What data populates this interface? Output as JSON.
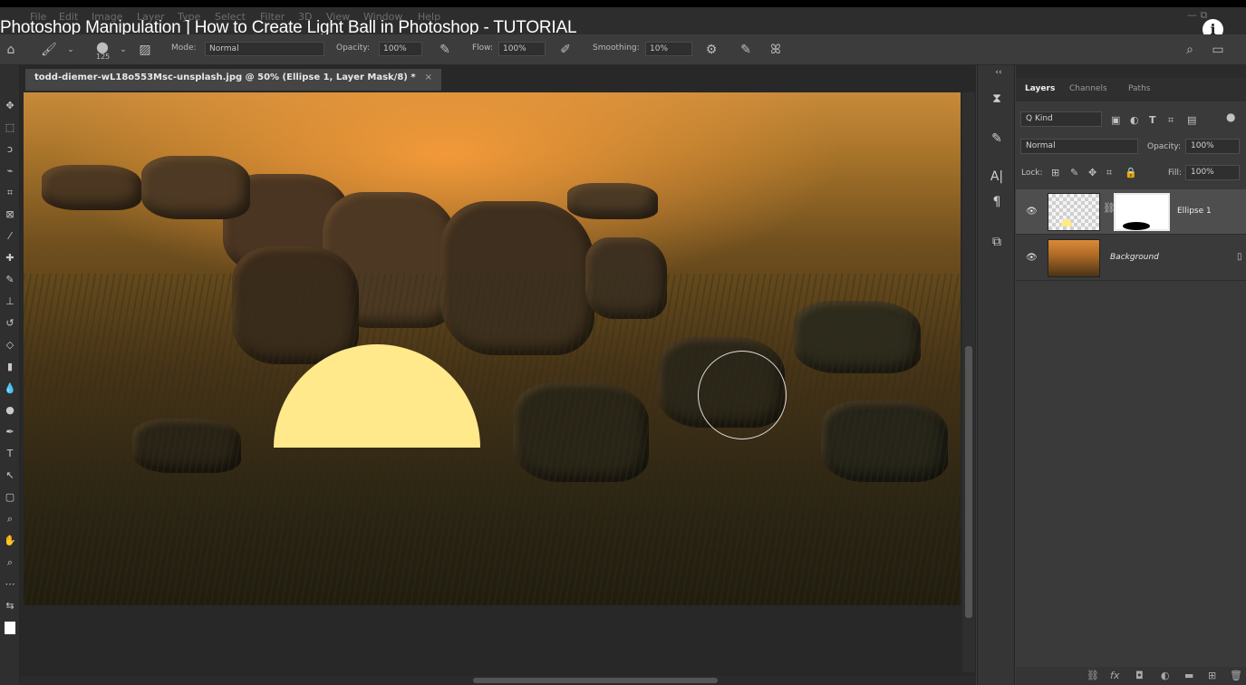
{
  "video": {
    "title": "Photoshop Manipulation ] How to Create Light Ball in Photoshop - TUTORIAL",
    "info_icon": "info-icon"
  },
  "menu": [
    "File",
    "Edit",
    "Image",
    "Layer",
    "Type",
    "Select",
    "Filter",
    "3D",
    "View",
    "Window",
    "Help"
  ],
  "options": {
    "brush_size": "125",
    "mode_label": "Mode:",
    "mode_value": "Normal",
    "opacity_label": "Opacity:",
    "opacity_value": "100%",
    "flow_label": "Flow:",
    "flow_value": "100%",
    "smoothing_label": "Smoothing:",
    "smoothing_value": "10%"
  },
  "document": {
    "tab_title": "todd-diemer-wL18o553Msc-unsplash.jpg @ 50% (Ellipse 1, Layer Mask/8) *",
    "tab_close": "×",
    "ellipse_color": "#ffe98a"
  },
  "panel": {
    "collapse": "‹‹",
    "tabs": [
      "Layers",
      "Channels",
      "Paths"
    ],
    "filter_value": "Q Kind",
    "blend_mode": "Normal",
    "opacity_label": "Opacity:",
    "opacity_value": "100%",
    "lock_label": "Lock:",
    "fill_label": "Fill:",
    "fill_value": "100%",
    "layers": [
      {
        "name": "Ellipse 1",
        "visible": true
      },
      {
        "name": "Background",
        "visible": true
      }
    ]
  }
}
